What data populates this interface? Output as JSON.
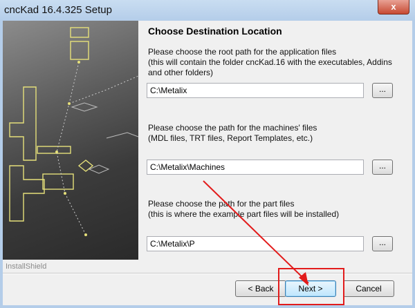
{
  "window": {
    "title": "cncKad 16.4.325 Setup",
    "close_glyph": "x"
  },
  "sidebar": {
    "brand": "InstallShield"
  },
  "page": {
    "heading": "Choose Destination Location",
    "sections": [
      {
        "desc_lines": [
          "Please choose the root path for the application files",
          "(this will contain the folder cncKad.16 with the executables, Addins",
          "and other folders)"
        ],
        "path": "C:\\Metalix",
        "browse": "..."
      },
      {
        "desc_lines": [
          "Please choose the path for the machines' files",
          "(MDL files, TRT files, Report Templates, etc.)"
        ],
        "path": "C:\\Metalix\\Machines",
        "browse": "..."
      },
      {
        "desc_lines": [
          "Please choose the path for the part files",
          "(this is where the example part files will be installed)"
        ],
        "path": "C:\\Metalix\\P",
        "browse": "..."
      }
    ]
  },
  "buttons": {
    "back": "< Back",
    "next": "Next >",
    "cancel": "Cancel"
  },
  "annotation": {
    "color": "#e21b1b"
  }
}
